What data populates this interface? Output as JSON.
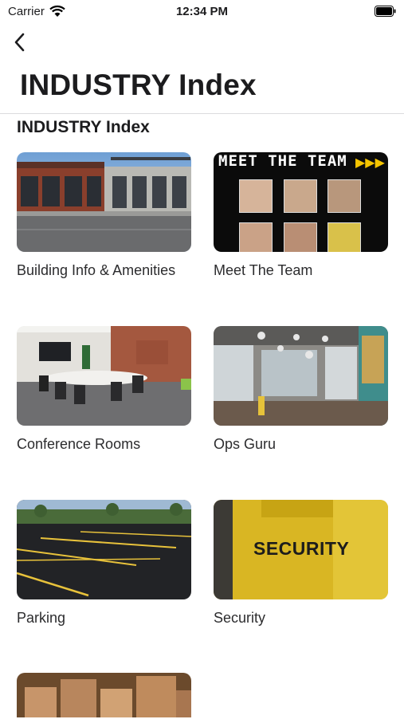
{
  "status": {
    "carrier": "Carrier",
    "time": "12:34 PM"
  },
  "nav": {
    "title": "INDUSTRY Index"
  },
  "section": {
    "title": "INDUSTRY Index"
  },
  "tiles": [
    {
      "label": "Building Info & Amenities"
    },
    {
      "label": "Meet The Team",
      "banner": "MEET THE TEAM"
    },
    {
      "label": "Conference Rooms"
    },
    {
      "label": "Ops Guru"
    },
    {
      "label": "Parking"
    },
    {
      "label": "Security",
      "jacket_text": "SECURITY"
    },
    {
      "label": ""
    }
  ],
  "icons": [
    "wifi-icon",
    "battery-icon",
    "back-chevron-icon"
  ]
}
